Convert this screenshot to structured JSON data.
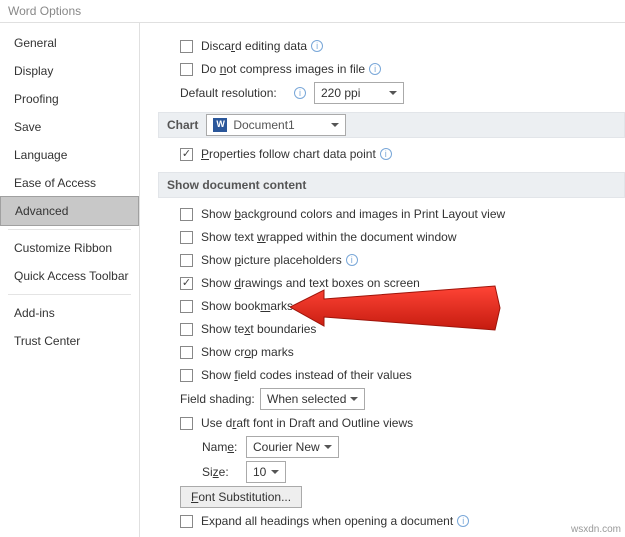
{
  "window_title": "Word Options",
  "sidebar": {
    "items": [
      {
        "label": "General"
      },
      {
        "label": "Display"
      },
      {
        "label": "Proofing"
      },
      {
        "label": "Save"
      },
      {
        "label": "Language"
      },
      {
        "label": "Ease of Access"
      },
      {
        "label": "Advanced"
      },
      {
        "label": "Customize Ribbon"
      },
      {
        "label": "Quick Access Toolbar"
      },
      {
        "label": "Add-ins"
      },
      {
        "label": "Trust Center"
      }
    ],
    "selected": "Advanced"
  },
  "top": {
    "discard": "Discard editing data",
    "compress": "Do not compress images in file",
    "def_res_label": "Default resolution:",
    "def_res_value": "220 ppi"
  },
  "chart_section": {
    "title": "Chart",
    "doc": "Document1",
    "follow": "Properties follow chart data point"
  },
  "doc_content": {
    "title": "Show document content",
    "bg": "Show background colors and images in Print Layout view",
    "wrap": "Show text wrapped within the document window",
    "pic_ph": "Show picture placeholders",
    "draw": "Show drawings and text boxes on screen",
    "bkmk": "Show bookmarks",
    "bound": "Show text boundaries",
    "crop": "Show crop marks",
    "field_codes": "Show field codes instead of their values",
    "field_shading_label": "Field shading:",
    "field_shading_value": "When selected",
    "draft": "Use draft font in Draft and Outline views",
    "name_label": "Name:",
    "name_value": "Courier New",
    "size_label": "Size:",
    "size_value": "10",
    "font_sub": "Font Substitution...",
    "expand": "Expand all headings when opening a document"
  },
  "watermark": "wsxdn.com"
}
